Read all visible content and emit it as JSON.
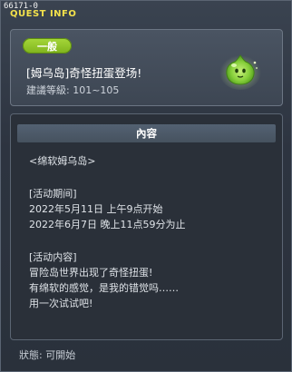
{
  "window": {
    "quest_id": "66171-0",
    "title": "QUEST INFO"
  },
  "quest": {
    "category": "一般",
    "name": "[姆乌岛]奇怪扭蛋登场!",
    "level_range": "建議等級: 101~105"
  },
  "content": {
    "header": "內容",
    "lines": [
      "<绵软姆乌岛>",
      "",
      "[活动期间]",
      "2022年5月11日 上午9点开始",
      "2022年6月7日 晚上11点59分为止",
      "",
      "[活动内容]",
      "冒险岛世界出现了奇怪扭蛋!",
      "有绵软的感觉，是我的错觉吗……",
      "用一次试试吧!"
    ]
  },
  "status": {
    "text": "狀態: 可開始"
  },
  "icons": {
    "slime": "green-slime-icon"
  },
  "colors": {
    "title": "#f4e24b",
    "badge": "#8fc22a"
  }
}
